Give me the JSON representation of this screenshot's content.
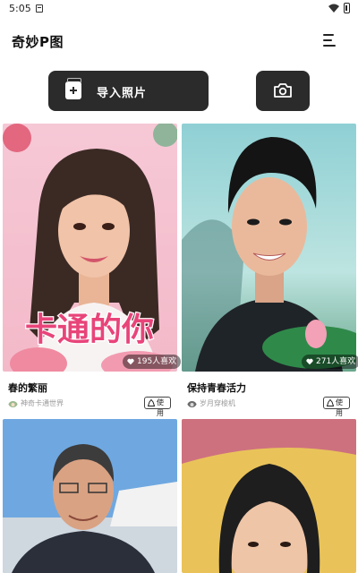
{
  "status_bar": {
    "time": "5:05"
  },
  "header": {
    "title": "奇妙P图"
  },
  "actions": {
    "import_label": "导入照片"
  },
  "feed": {
    "cards": [
      {
        "title": "春的繁丽",
        "author": "神奇卡通世界",
        "likes": "195人喜欢",
        "use_label": "使用",
        "overlay_text": "卡通的你"
      },
      {
        "title": "保持青春活力",
        "author": "岁月穿梭机",
        "likes": "271人喜欢",
        "use_label": "使用"
      }
    ]
  },
  "colors": {
    "button_bg": "#2b2b2b",
    "overlay_text": "#e8447a"
  },
  "icons": {
    "menu": "hamburger-icon",
    "import": "add-photo-icon",
    "camera": "camera-icon",
    "like": "heart-icon",
    "use": "sparkle-icon"
  }
}
